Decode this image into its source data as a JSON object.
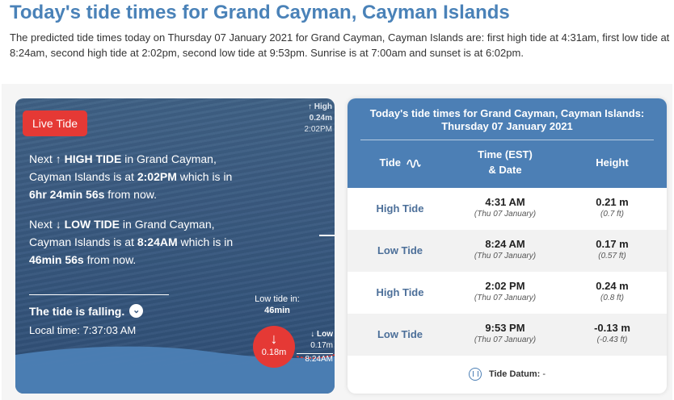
{
  "page": {
    "title": "Today's tide times for Grand Cayman, Cayman Islands",
    "intro": "The predicted tide times today on Thursday 07 January 2021 for Grand Cayman, Cayman Islands are: first high tide at 4:31am, first low tide at 8:24am, second high tide at 2:02pm, second low tide at 9:53pm. Sunrise is at 7:00am and sunset is at 6:02pm."
  },
  "live": {
    "button_label": "Live Tide",
    "next_high": {
      "prefix": "Next ",
      "arrow": "↑",
      "label": "HIGH TIDE",
      "mid": " in Grand Cayman, Cayman Islands is at ",
      "time": "2:02PM",
      "mid2": " which is in ",
      "countdown": "6hr 24min 56s",
      "suffix": " from now."
    },
    "next_low": {
      "prefix": "Next ",
      "arrow": "↓",
      "label": "LOW TIDE",
      "mid": " in Grand Cayman, Cayman Islands is at ",
      "time": "8:24AM",
      "mid2": " which is in ",
      "countdown": "46min 56s",
      "suffix": " from now."
    },
    "falling_text": "The tide is falling.",
    "local_time": "Local time: 7:37:03 AM",
    "chart": {
      "high_marker": {
        "arrow": "↑",
        "label": "High",
        "height": "0.24m",
        "time": "2:02PM"
      },
      "low_in_label": "Low tide in:",
      "low_in_value": "46min",
      "current_arrow": "↓",
      "current_height": "0.18m",
      "low_marker": {
        "arrow": "↓",
        "label": "Low",
        "height": "0.17m",
        "time": "8:24AM"
      }
    }
  },
  "table": {
    "title": "Today's tide times for Grand Cayman, Cayman Islands:",
    "subtitle": "Thursday 07 January 2021",
    "headers": {
      "tide": "Tide",
      "time": "Time (EST)",
      "time2": "& Date",
      "height": "Height"
    },
    "rows": [
      {
        "tide": "High Tide",
        "time": "4:31 AM",
        "date": "(Thu 07 January)",
        "height": "0.21 m",
        "height_ft": "(0.7 ft)"
      },
      {
        "tide": "Low Tide",
        "time": "8:24 AM",
        "date": "(Thu 07 January)",
        "height": "0.17 m",
        "height_ft": "(0.57 ft)"
      },
      {
        "tide": "High Tide",
        "time": "2:02 PM",
        "date": "(Thu 07 January)",
        "height": "0.24 m",
        "height_ft": "(0.8 ft)"
      },
      {
        "tide": "Low Tide",
        "time": "9:53 PM",
        "date": "(Thu 07 January)",
        "height": "-0.13 m",
        "height_ft": "(-0.43 ft)"
      }
    ],
    "datum_label": "Tide Datum:",
    "datum_value": "-"
  },
  "colors": {
    "title_blue": "#4a82b8",
    "table_header": "#4c7fb5",
    "live_red": "#e53935"
  },
  "icons": [
    "wave-icon",
    "arrow-up-icon",
    "arrow-down-icon",
    "chevron-down-icon",
    "tide-datum-icon"
  ]
}
